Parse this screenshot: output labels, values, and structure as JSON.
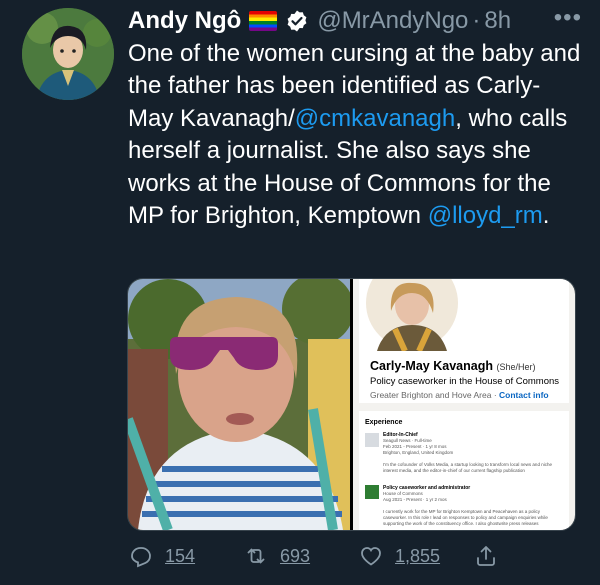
{
  "tweet": {
    "author_name": "Andy Ngô",
    "handle": "@MrAndyNgo",
    "separator": "·",
    "time": "8h",
    "more_label": "•••",
    "text_parts": {
      "p1": "One of the women cursing at the baby and the father has been identified as Carly-May Kavanagh/",
      "mention1": "@cmkavanagh",
      "p2": ", who calls herself a journalist. She also says she works at the House of Commons for the MP for Brighton, Kemptown ",
      "mention2": "@lloyd_rm",
      "p3": "."
    },
    "icons": {
      "flag": "rainbow-flag-icon",
      "verified": "verified-badge-icon"
    }
  },
  "linkedin": {
    "name": "Carly-May Kavanagh",
    "pronouns": "(She/Her)",
    "headline": "Policy caseworker in the House of Commons",
    "location": "Greater Brighton and Hove Area",
    "dot": "·",
    "contact": "Contact info",
    "experience_header": "Experience",
    "items": [
      {
        "title": "Editor-In-Chief",
        "company": "Seagull News · Full-time",
        "dates": "Feb 2021 - Present · 1 yr 8 mos",
        "place": "Brighton, England, United Kingdom",
        "desc": "I'm the cofounder of Volks Media, a startup looking to transform local news and niche interest media, and the editor-in-chief of our current flagship publication"
      },
      {
        "title": "Policy caseworker and administrator",
        "company": "House of Commons",
        "dates": "Aug 2021 - Present · 1 yr 2 mos",
        "desc": "I currently work for the MP for Brighton Kemptown and Peacehaven as a policy caseworker. In this role I lead on responses to policy and campaign enquiries while supporting the work of the constituency office. I also ghostwrite press releases"
      }
    ]
  },
  "actions": {
    "reply": {
      "icon": "reply-icon",
      "count": "154"
    },
    "retweet": {
      "icon": "retweet-icon",
      "count": "693"
    },
    "like": {
      "icon": "heart-icon",
      "count": "1,855"
    },
    "share": {
      "icon": "share-icon"
    }
  },
  "colors": {
    "background": "#15202b",
    "link": "#1d9bf0",
    "muted": "#8899a6",
    "linkedin_blue": "#0a66c2"
  }
}
